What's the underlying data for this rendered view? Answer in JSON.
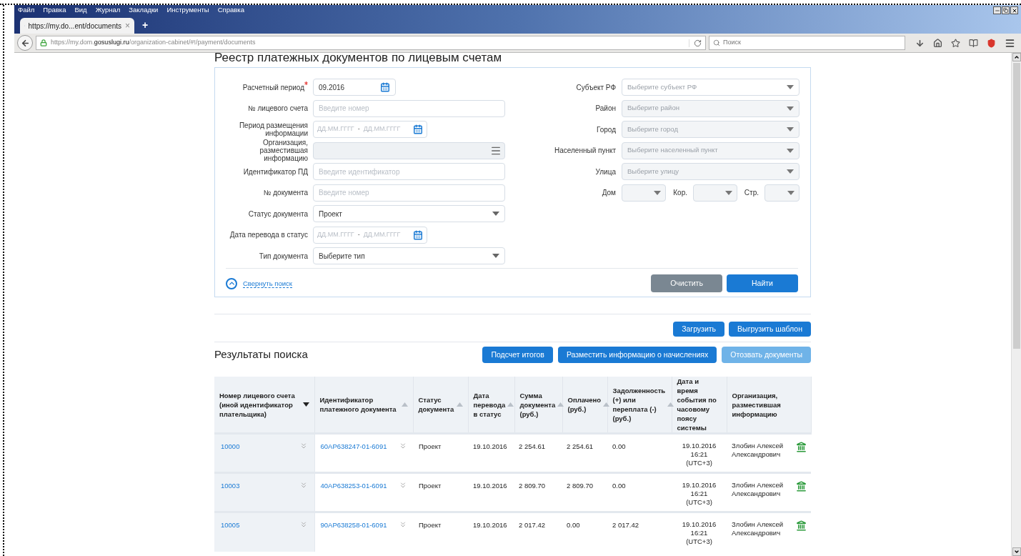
{
  "browser": {
    "menu": [
      "Файл",
      "Правка",
      "Вид",
      "Журнал",
      "Закладки",
      "Инструменты",
      "Справка"
    ],
    "tab": {
      "title": "https://my.do...ent/documents",
      "close": "×"
    },
    "new_tab": "+",
    "url": {
      "scheme": "https://my.dom.",
      "host": "gosuslugi.ru",
      "path": "/organization-cabinet/#!/payment/documents"
    },
    "search": {
      "placeholder": "Поиск"
    }
  },
  "page": {
    "title": "Реестр платежных документов по лицевым счетам"
  },
  "filters": {
    "left": [
      {
        "label": "Расчетный период",
        "required": true,
        "disabled": false,
        "kind": "month",
        "value": "09.2016"
      },
      {
        "label": "№ лицевого счета",
        "required": false,
        "disabled": false,
        "kind": "text",
        "placeholder": "Введите номер"
      },
      {
        "label": "Период размещения информации",
        "required": false,
        "disabled": false,
        "kind": "range",
        "from_placeholder": "ДД.ММ.ГГГГ",
        "separator": "-",
        "to_placeholder": "ДД.ММ.ГГГГ"
      },
      {
        "label": "Организация, разместившая информацию",
        "required": false,
        "disabled": true,
        "kind": "list"
      },
      {
        "label": "Идентификатор ПД",
        "required": false,
        "disabled": false,
        "kind": "text",
        "placeholder": "Введите идентификатор"
      },
      {
        "label": "№ документа",
        "required": false,
        "disabled": false,
        "kind": "text",
        "placeholder": "Введите номер"
      },
      {
        "label": "Статус документа",
        "required": false,
        "disabled": false,
        "kind": "select",
        "value": "Проект"
      },
      {
        "label": "Дата перевода в статус",
        "required": false,
        "disabled": false,
        "kind": "range",
        "from_placeholder": "ДД.ММ.ГГГГ",
        "separator": "-",
        "to_placeholder": "ДД.ММ.ГГГГ"
      },
      {
        "label": "Тип документа",
        "required": false,
        "disabled": false,
        "kind": "select",
        "value": "Выберите тип"
      }
    ],
    "right": [
      {
        "label": "Субъект РФ",
        "placeholder": "Выберите субъект РФ",
        "disabled": false
      },
      {
        "label": "Район",
        "placeholder": "Выберите район",
        "disabled": true
      },
      {
        "label": "Город",
        "placeholder": "Выберите город",
        "disabled": true
      },
      {
        "label": "Населенный пункт",
        "placeholder": "Выберите населенный пункт",
        "disabled": true
      },
      {
        "label": "Улица",
        "placeholder": "Выберите улицу",
        "disabled": true
      }
    ],
    "house": [
      {
        "label": "Дом",
        "disabled": true
      },
      {
        "label": "Кор.",
        "disabled": true
      },
      {
        "label": "Стр.",
        "disabled": true
      }
    ],
    "collapse_link": "Свернуть поиск",
    "buttons": [
      {
        "label": "Очистить",
        "kind": "secondary"
      },
      {
        "label": "Найти",
        "kind": "primary"
      }
    ]
  },
  "file_buttons": [
    {
      "label": "Загрузить",
      "disabled": false
    },
    {
      "label": "Выгрузить шаблон",
      "disabled": false
    }
  ],
  "results": {
    "title": "Результаты поиска",
    "buttons": [
      {
        "label": "Подсчет итогов",
        "disabled": false
      },
      {
        "label": "Разместить информацию о начислениях",
        "disabled": false
      },
      {
        "label": "Отозвать документы",
        "disabled": true
      }
    ],
    "columns": [
      {
        "label": "Номер лицевого счета (иной идентификатор плательщика)",
        "sortable": true,
        "sorted": true
      },
      {
        "label": "Идентификатор платежного документа",
        "sortable": true,
        "sorted": false
      },
      {
        "label": "Статус документа",
        "sortable": true,
        "sorted": false
      },
      {
        "label": "Дата перевода в статус",
        "sortable": true,
        "sorted": false
      },
      {
        "label": "Сумма документа (руб.)",
        "sortable": true,
        "sorted": false
      },
      {
        "label": "Оплачено (руб.)",
        "sortable": true,
        "sorted": false
      },
      {
        "label": "Задолженность (+) или переплата (-) (руб.)",
        "sortable": true,
        "sorted": false
      },
      {
        "label": "Дата и время события по часовому поясу системы",
        "sortable": false
      },
      {
        "label": "Организация, разместившая информацию",
        "sortable": false
      }
    ],
    "rows": [
      {
        "account": "10000",
        "document_id": "60AP638247-01-6091",
        "status": "Проект",
        "status_date": "19.10.2016",
        "amount": "2 254.61",
        "paid": "2 254.61",
        "debt": "0.00",
        "event_time": [
          "19.10.2016",
          "16:21",
          "(UTC+3)"
        ],
        "organization": "Злобин Алексей Александрович"
      },
      {
        "account": "10003",
        "document_id": "40AP638253-01-6091",
        "status": "Проект",
        "status_date": "19.10.2016",
        "amount": "2 809.70",
        "paid": "2 809.70",
        "debt": "0.00",
        "event_time": [
          "19.10.2016",
          "16:21",
          "(UTC+3)"
        ],
        "organization": "Злобин Алексей Александрович"
      },
      {
        "account": "10005",
        "document_id": "90AP638258-01-6091",
        "status": "Проект",
        "status_date": "19.10.2016",
        "amount": "2 017.42",
        "paid": "0.00",
        "debt": "2 017.42",
        "event_time": [
          "19.10.2016",
          "16:21",
          "(UTC+3)"
        ],
        "organization": "Злобин Алексей Александрович"
      }
    ]
  }
}
